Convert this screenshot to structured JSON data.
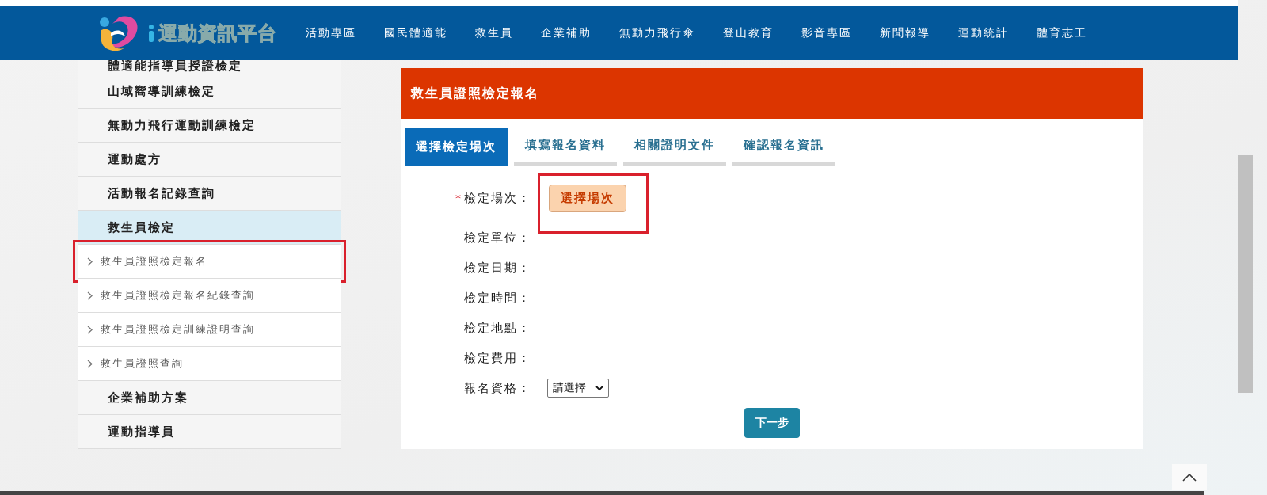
{
  "header": {
    "logo_text": "運動資訊平台",
    "nav": [
      "活動專區",
      "國民體適能",
      "救生員",
      "企業補助",
      "無動力飛行傘",
      "登山教育",
      "影音專區",
      "新聞報導",
      "運動統計",
      "體育志工"
    ]
  },
  "sidebar": {
    "items": [
      {
        "label": "體適能指導員授證檢定",
        "kind": "section",
        "selected": false,
        "highlighted": false
      },
      {
        "label": "山域嚮導訓練檢定",
        "kind": "section",
        "selected": false,
        "highlighted": false
      },
      {
        "label": "無動力飛行運動訓練檢定",
        "kind": "section",
        "selected": false,
        "highlighted": false
      },
      {
        "label": "運動處方",
        "kind": "section",
        "selected": false,
        "highlighted": false
      },
      {
        "label": "活動報名記錄查詢",
        "kind": "section",
        "selected": false,
        "highlighted": false
      },
      {
        "label": "救生員檢定",
        "kind": "section",
        "selected": true,
        "highlighted": false
      },
      {
        "label": "救生員證照檢定報名",
        "kind": "sub",
        "selected": false,
        "highlighted": true
      },
      {
        "label": "救生員證照檢定報名紀錄查詢",
        "kind": "sub",
        "selected": false,
        "highlighted": false
      },
      {
        "label": "救生員證照檢定訓練證明查詢",
        "kind": "sub",
        "selected": false,
        "highlighted": false
      },
      {
        "label": "救生員證照查詢",
        "kind": "sub",
        "selected": false,
        "highlighted": false
      },
      {
        "label": "企業補助方案",
        "kind": "section",
        "selected": false,
        "highlighted": false
      },
      {
        "label": "運動指導員",
        "kind": "section",
        "selected": false,
        "highlighted": false
      }
    ]
  },
  "panel": {
    "title": "救生員證照檢定報名",
    "tabs": [
      {
        "label": "選擇檢定場次",
        "selected": true
      },
      {
        "label": "填寫報名資料",
        "selected": false
      },
      {
        "label": "相關證明文件",
        "selected": false
      },
      {
        "label": "確認報名資訊",
        "selected": false
      }
    ],
    "fields": [
      {
        "label": "檢定場次：",
        "mark": "*",
        "kind": "button",
        "button": "選擇場次",
        "highlighted": true
      },
      {
        "label": "檢定單位：",
        "kind": "text"
      },
      {
        "label": "檢定日期：",
        "kind": "text"
      },
      {
        "label": "檢定時間：",
        "kind": "text"
      },
      {
        "label": "檢定地點：",
        "kind": "text"
      },
      {
        "label": "檢定費用：",
        "kind": "text"
      },
      {
        "label": "報名資格：",
        "kind": "select",
        "value": "請選擇"
      }
    ],
    "next_button": "下一步"
  }
}
